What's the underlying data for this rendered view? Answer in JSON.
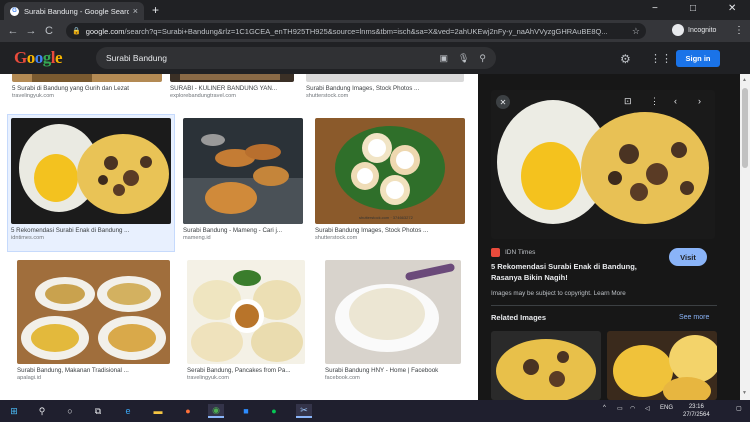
{
  "browser": {
    "tab_title": "Surabi Bandung - Google Search",
    "tab_close": "×",
    "new_tab": "+",
    "url_host": "google.com",
    "url_path": "/search?q=Surabi+Bandung&rlz=1C1GCEA_enTH925TH925&source=lnms&tbm=isch&sa=X&ved=2ahUKEwj2nFy-y_naAhVVyzgGHRAuBE8Q...",
    "incognito_label": "Incognito",
    "nav": {
      "back": "←",
      "forward": "→",
      "reload": "C"
    },
    "window": {
      "minimize": "−",
      "maximize": "□",
      "close": "✕"
    }
  },
  "google": {
    "logo_letters": [
      "G",
      "o",
      "o",
      "g",
      "l",
      "e"
    ],
    "query": "Surabi Bandung",
    "signin_label": "Sign in"
  },
  "results": {
    "row0": [
      {
        "title": "5 Surabi di Bandung yang Gurih dan Lezat",
        "source": "travelingyuk.com"
      },
      {
        "title": "SURABI - KULINER BANDUNG YAN...",
        "source": "explorebandungtravel.com"
      },
      {
        "title": "Surabi Bandung Images, Stock Photos ...",
        "source": "shutterstock.com"
      }
    ],
    "row1": [
      {
        "title": "5 Rekomendasi Surabi Enak di Bandung ...",
        "source": "idntimes.com"
      },
      {
        "title": "Surabi Bandung - Mameng - Cari j...",
        "source": "mameng.id"
      },
      {
        "title": "Surabi Bandung Images, Stock Photos ...",
        "source": "shutterstock.com",
        "watermark": "shutterstock.com · 374663272"
      }
    ],
    "row2": [
      {
        "title": "Surabi Bandung, Makanan Tradisional ...",
        "source": "apalagi.id"
      },
      {
        "title": "Serabi Bandung, Pancakes from Pa...",
        "source": "travelingyuk.com"
      },
      {
        "title": "Surabi Bandung HNY - Home | Facebook",
        "source": "facebook.com"
      }
    ]
  },
  "panel": {
    "source_name": "IDN Times",
    "title": "5 Rekomendasi Surabi Enak di Bandung, Rasanya Bikin Nagih!",
    "visit_label": "Visit",
    "copyright_text": "Images may be subject to copyright.",
    "learn_more": "Learn More",
    "related_title": "Related Images",
    "see_more": "See more"
  },
  "taskbar": {
    "lang": "ENG",
    "time": "23:16",
    "date": "27/7/2564"
  },
  "colors": {
    "chrome_dark": "#202124",
    "accent_blue": "#1a73e8",
    "link_blue": "#8ab4f8"
  }
}
